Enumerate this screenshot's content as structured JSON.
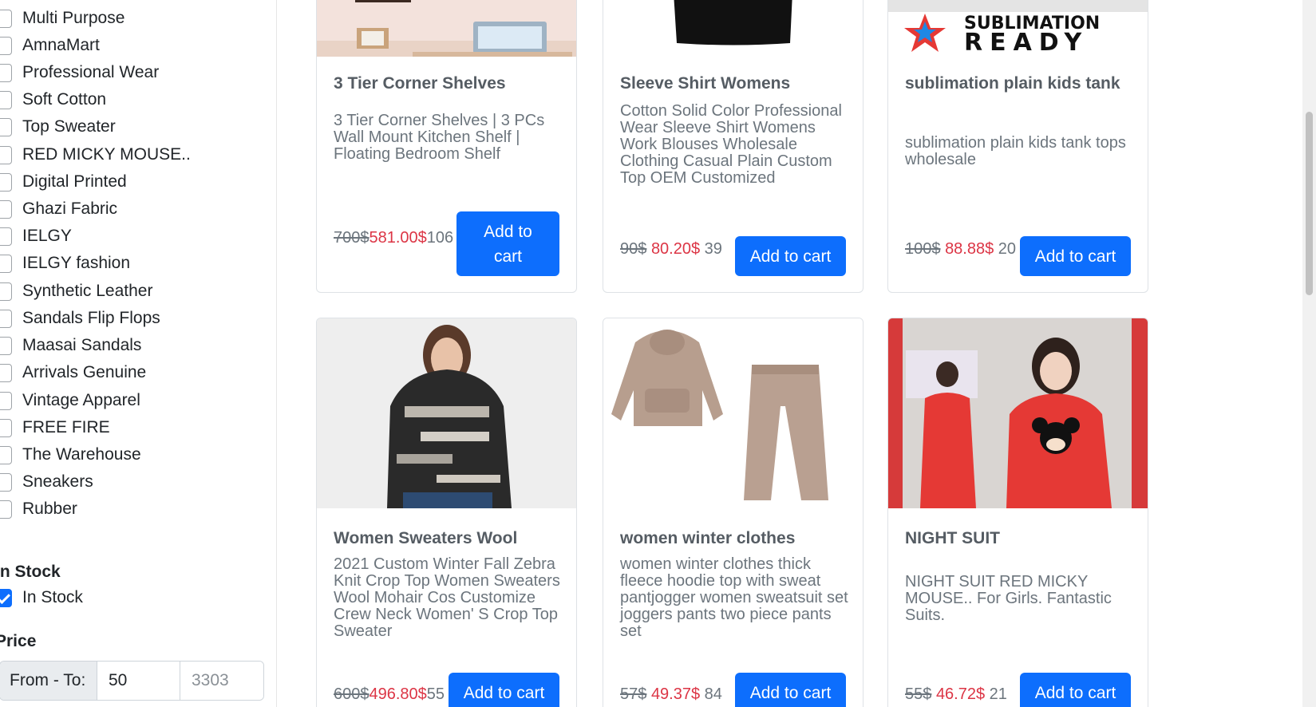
{
  "sidebar": {
    "brands": [
      {
        "label": "Multi Purpose",
        "checked": false
      },
      {
        "label": "AmnaMart",
        "checked": false
      },
      {
        "label": "Professional Wear",
        "checked": false
      },
      {
        "label": "Soft Cotton",
        "checked": false
      },
      {
        "label": "Top Sweater",
        "checked": false
      },
      {
        "label": "RED MICKY MOUSE..",
        "checked": false
      },
      {
        "label": "Digital Printed",
        "checked": false
      },
      {
        "label": "Ghazi Fabric",
        "checked": false
      },
      {
        "label": "IELGY",
        "checked": false
      },
      {
        "label": "IELGY fashion",
        "checked": false
      },
      {
        "label": "Synthetic Leather",
        "checked": false
      },
      {
        "label": "Sandals Flip Flops",
        "checked": false
      },
      {
        "label": "Maasai Sandals",
        "checked": false
      },
      {
        "label": "Arrivals Genuine",
        "checked": false
      },
      {
        "label": "Vintage Apparel",
        "checked": false
      },
      {
        "label": "FREE FIRE",
        "checked": false
      },
      {
        "label": "The Warehouse",
        "checked": false
      },
      {
        "label": "Sneakers",
        "checked": false
      },
      {
        "label": "Rubber",
        "checked": false
      }
    ],
    "stock_title": "In Stock",
    "stock_option": {
      "label": "In Stock",
      "checked": true
    },
    "price_title": "Price",
    "price_label": "From - To:",
    "price_from": "50",
    "price_to_placeholder": "3303"
  },
  "products": [
    {
      "title": "3 Tier Corner Shelves",
      "description": "3 Tier Corner Shelves | 3 PCs Wall Mount Kitchen Shelf | Floating Bedroom Shelf",
      "old_price": "700$",
      "new_price": "581.00$",
      "stock": "106",
      "button": "Add to cart"
    },
    {
      "title": "Sleeve Shirt Womens",
      "description": "Cotton Solid Color Professional Wear Sleeve Shirt Womens Work Blouses Wholesale Clothing Casual Plain Custom Top OEM Customized",
      "old_price": "90$",
      "new_price": "80.20$",
      "stock": "39",
      "button": "Add to cart"
    },
    {
      "title": "sublimation plain kids tank",
      "description": "sublimation plain kids tank tops wholesale",
      "old_price": "100$",
      "new_price": "88.88$",
      "stock": "20",
      "button": "Add to cart",
      "image_text": "SUBLIMATION READY"
    },
    {
      "title": "Women Sweaters Wool",
      "description": "2021 Custom Winter Fall Zebra Knit Crop Top Women Sweaters Wool Mohair Cos Customize Crew Neck Women' S Crop Top Sweater",
      "old_price": "600$",
      "new_price": "496.80$",
      "stock": "55",
      "button": "Add to cart"
    },
    {
      "title": "women winter clothes",
      "description": "women winter clothes thick fleece hoodie top with sweat pantjogger women sweatsuit set joggers pants two piece pants set",
      "old_price": "57$",
      "new_price": "49.37$",
      "stock": "84",
      "button": "Add to cart"
    },
    {
      "title": "NIGHT SUIT",
      "description": "NIGHT SUIT RED MICKY MOUSE.. For Girls. Fantastic Suits.",
      "old_price": "55$",
      "new_price": "46.72$",
      "stock": "21",
      "button": "Add to cart"
    }
  ],
  "colors": {
    "primary": "#0d6efd",
    "sale_price": "#dc3545",
    "muted": "#6c757d"
  }
}
